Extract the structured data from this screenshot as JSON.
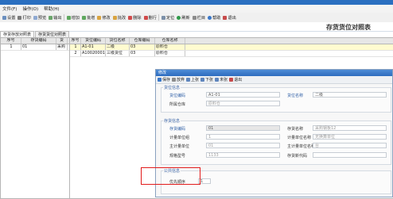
{
  "menu": [
    "文件(F)",
    "操作(O)",
    "帮助(H)"
  ],
  "toolbar": [
    "设置",
    "打印",
    "预览",
    "输出",
    "增加",
    "批增",
    "修改",
    "批改",
    "删除",
    "删行",
    "定位",
    "刷新",
    "栏目",
    "帮助",
    "退出"
  ],
  "page": {
    "title": "存货货位对照表"
  },
  "tabs": [
    "存货存放对照表",
    "存货货位对照表"
  ],
  "left_grid": {
    "headers": [
      "序号",
      "存货编码",
      "货"
    ],
    "rows": [
      [
        "1",
        "01",
        "采购"
      ]
    ]
  },
  "right_grid": {
    "headers": [
      "序号",
      "货位编码",
      "货位名称",
      "仓库编码",
      "仓库名称"
    ],
    "rows": [
      [
        "1",
        "A1-01",
        "二级",
        "03",
        "原料仓"
      ],
      [
        "2",
        "A10020001",
        "三级货位",
        "03",
        "原料仓"
      ]
    ]
  },
  "dialog": {
    "title": "修改",
    "tools": [
      "保存",
      "放弃",
      "上张",
      "下张",
      "末张",
      "退出"
    ],
    "section_location": {
      "title": "货位信息",
      "code_label": "货位编码",
      "code_value": "A1-01",
      "name_label": "货位名称",
      "name_value": "二级",
      "wh_label": "所属仓库",
      "wh_value": "原料仓"
    },
    "section_inventory": {
      "title": "存货信息",
      "code_label": "存货编码",
      "code_value": "01",
      "name_label": "存货名称",
      "name_value": "采购钢板12",
      "group_label": "计量单位组",
      "group_value": "1",
      "unitname_label": "计量单位名称",
      "unitname_value": "无换算单位",
      "mainunit_label": "主计量单位",
      "mainunit_value": "01",
      "mainunitname_label": "主计量单位名称",
      "mainunitname_value": "台",
      "spec_label": "规格型号",
      "spec_value": "1133",
      "invcls_label": "存货新代码",
      "invcls_value": ""
    },
    "section_public": {
      "title": "公共信息",
      "priority_label": "优先顺序",
      "priority_value": "1"
    }
  }
}
